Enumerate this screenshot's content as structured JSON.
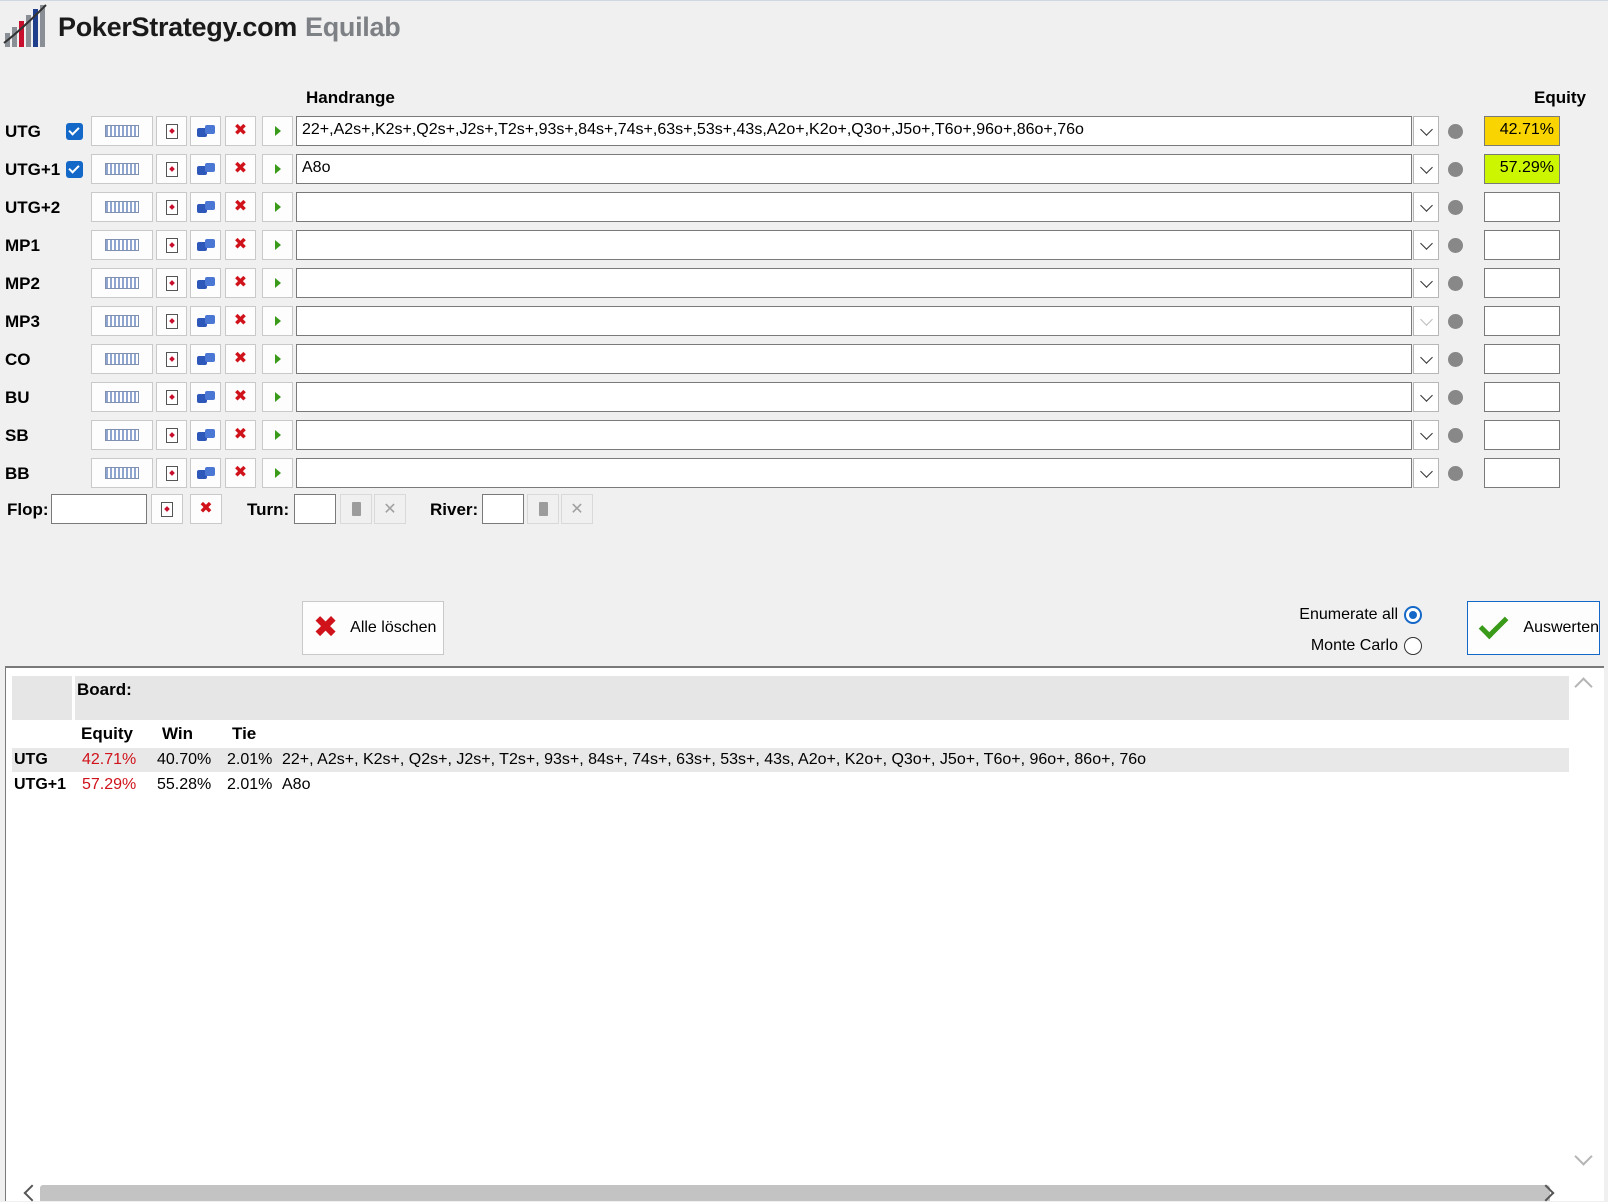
{
  "app": {
    "brand": "PokerStrategy.com",
    "product": "Equilab"
  },
  "columns": {
    "handrange": "Handrange",
    "equity": "Equity"
  },
  "players": [
    {
      "pos": "UTG",
      "checked": true,
      "range": "22+,A2s+,K2s+,Q2s+,J2s+,T2s+,93s+,84s+,74s+,63s+,53s+,43s,A2o+,K2o+,Q3o+,J5o+,T6o+,96o+,86o+,76o",
      "equity": "42.71%",
      "equity_color": "#f9d400"
    },
    {
      "pos": "UTG+1",
      "checked": true,
      "range": "A8o",
      "equity": "57.29%",
      "equity_color": "#ccf500"
    },
    {
      "pos": "UTG+2",
      "checked": false,
      "range": "",
      "equity": ""
    },
    {
      "pos": "MP1",
      "checked": false,
      "range": "",
      "equity": ""
    },
    {
      "pos": "MP2",
      "checked": false,
      "range": "",
      "equity": ""
    },
    {
      "pos": "MP3",
      "checked": false,
      "range": "",
      "equity": "",
      "dropdown_disabled": true
    },
    {
      "pos": "CO",
      "checked": false,
      "range": "",
      "equity": ""
    },
    {
      "pos": "BU",
      "checked": false,
      "range": "",
      "equity": ""
    },
    {
      "pos": "SB",
      "checked": false,
      "range": "",
      "equity": ""
    },
    {
      "pos": "BB",
      "checked": false,
      "range": "",
      "equity": ""
    }
  ],
  "board": {
    "flop_label": "Flop:",
    "turn_label": "Turn:",
    "river_label": "River:",
    "flop_value": "",
    "turn_value": "",
    "river_value": ""
  },
  "actions": {
    "clear_all": "Alle löschen",
    "enumerate_all": "Enumerate all",
    "monte_carlo": "Monte Carlo",
    "evaluate": "Auswerten",
    "selected_mode": "enumerate_all"
  },
  "results": {
    "board_label": "Board:",
    "headers": {
      "equity": "Equity",
      "win": "Win",
      "tie": "Tie"
    },
    "rows": [
      {
        "pos": "UTG",
        "equity": "42.71%",
        "win": "40.70%",
        "tie": "2.01%",
        "range": "22+, A2s+, K2s+, Q2s+, J2s+, T2s+, 93s+, 84s+, 74s+, 63s+, 53s+, 43s, A2o+, K2o+, Q3o+, J5o+, T6o+, 96o+, 86o+, 76o"
      },
      {
        "pos": "UTG+1",
        "equity": "57.29%",
        "win": "55.28%",
        "tie": "2.01%",
        "range": "A8o"
      }
    ]
  },
  "colors": {
    "accent": "#1468c8",
    "equity_red": "#d0121b",
    "delete_red": "#d0121b",
    "go_green": "#3a9b1b"
  }
}
